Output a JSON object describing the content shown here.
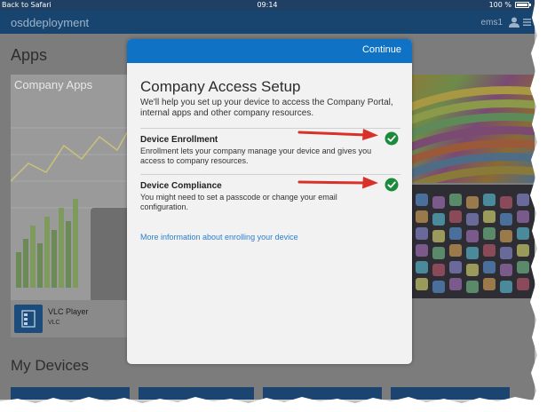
{
  "status_bar": {
    "back_label": "Back to Safari",
    "time": "09:14",
    "battery_text": "100 %",
    "battery_level": 1.0
  },
  "nav": {
    "title": "osddeployment",
    "user": "ems1",
    "user_icon": "user-icon",
    "menu_icon": "menu-icon"
  },
  "background": {
    "apps_heading": "Apps",
    "company_apps_label": "Company Apps",
    "app_card": {
      "name": "VLC Player",
      "publisher": "VLC",
      "icon": "vlc-app-icon"
    },
    "my_devices_heading": "My Devices"
  },
  "modal": {
    "continue_label": "Continue",
    "title": "Company Access Setup",
    "intro": "We'll help you set up your device to access the Company Portal, internal apps and other company resources.",
    "sections": [
      {
        "title": "Device Enrollment",
        "description": "Enrollment lets your company manage your device and gives you access to company resources.",
        "status_icon": "check-circle-icon"
      },
      {
        "title": "Device Compliance",
        "description": "You might need to set a passcode or change your email configuration.",
        "status_icon": "check-circle-icon"
      }
    ],
    "more_info_link": "More information about enrolling your device"
  },
  "colors": {
    "header_blue": "#0f72c5",
    "nav_blue": "#18456f",
    "check_green": "#1b8a3a",
    "arrow_red": "#d9302a",
    "link_blue": "#2a7fd0"
  }
}
